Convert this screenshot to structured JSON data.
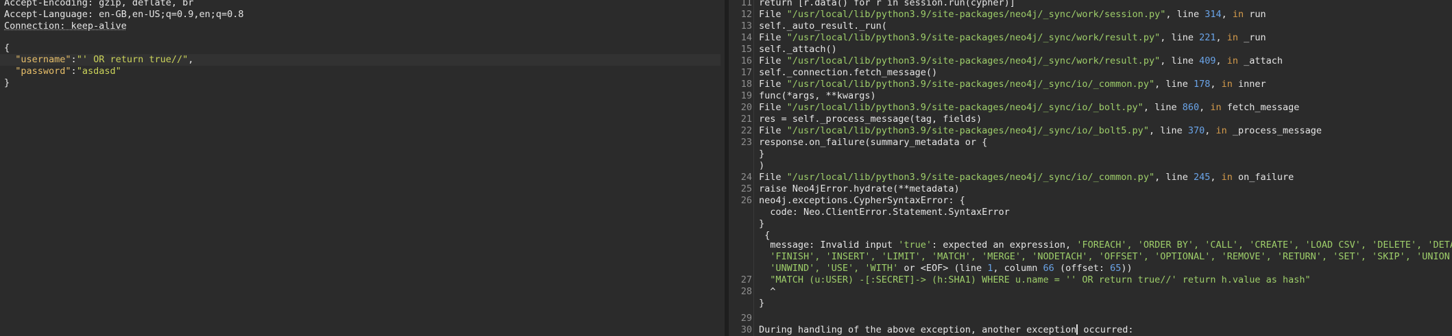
{
  "request": {
    "header_encoding": "Accept-Encoding: gzip, deflate, br",
    "header_language": "Accept-Language: en-GB,en-US;q=0.9,en;q=0.8",
    "header_connection": "Connection: keep-alive",
    "brace_open": "{",
    "username_key": "\"username\"",
    "username_val": "\"' OR return true//\"",
    "password_key": "\"password\"",
    "password_val": "\"asdasd\"",
    "brace_close": "}",
    "colon": ":",
    "comma": ","
  },
  "trace": {
    "lines": [
      {
        "n": "11",
        "a": "return [r.data() for r in session.run(cypher)]"
      },
      {
        "n": "12",
        "file": "\"/usr/local/lib/python3.9/site-packages/neo4j/_sync/work/session.py\"",
        "line": "314",
        "in": "run"
      },
      {
        "n": "13",
        "a": "self._auto_result._run("
      },
      {
        "n": "14",
        "file": "\"/usr/local/lib/python3.9/site-packages/neo4j/_sync/work/result.py\"",
        "line": "221",
        "in": "_run"
      },
      {
        "n": "15",
        "a": "self._attach()"
      },
      {
        "n": "16",
        "file": "\"/usr/local/lib/python3.9/site-packages/neo4j/_sync/work/result.py\"",
        "line": "409",
        "in": "_attach"
      },
      {
        "n": "17",
        "a": "self._connection.fetch_message()"
      },
      {
        "n": "18",
        "file": "\"/usr/local/lib/python3.9/site-packages/neo4j/_sync/io/_common.py\"",
        "line": "178",
        "in": "inner"
      },
      {
        "n": "19",
        "a": "func(*args, **kwargs)"
      },
      {
        "n": "20",
        "file": "\"/usr/local/lib/python3.9/site-packages/neo4j/_sync/io/_bolt.py\"",
        "line": "860",
        "in": "fetch_message"
      },
      {
        "n": "21",
        "a": "res = self._process_message(tag, fields)"
      },
      {
        "n": "22",
        "file": "\"/usr/local/lib/python3.9/site-packages/neo4j/_sync/io/_bolt5.py\"",
        "line": "370",
        "in": "_process_message"
      },
      {
        "n": "23",
        "a": "response.on_failure(summary_metadata or {"
      },
      {
        "n": "",
        "a": "}"
      },
      {
        "n": "",
        "a": ")"
      },
      {
        "n": "24",
        "file": "\"/usr/local/lib/python3.9/site-packages/neo4j/_sync/io/_common.py\"",
        "line": "245",
        "in": "on_failure"
      },
      {
        "n": "25",
        "a": "raise Neo4jError.hydrate(**metadata)"
      },
      {
        "n": "26",
        "a": "neo4j.exceptions.CypherSyntaxError: {"
      },
      {
        "n": "",
        "a": "  code: Neo.ClientError.Statement.SyntaxError"
      },
      {
        "n": "",
        "a": "}"
      },
      {
        "n": "",
        "a": " {"
      }
    ],
    "file_word": "File",
    "line_word": "line",
    "in_word": "in",
    "msg1_pre": "  message: Invalid input ",
    "msg1_true": "'true'",
    "msg1_mid": ": expected an expression, ",
    "msg1_list": "'FOREACH', 'ORDER BY', 'CALL', 'CREATE', 'LOAD CSV', 'DELETE', 'DETACH'",
    "msg2": "  'FINISH', 'INSERT', 'LIMIT', 'MATCH', 'MERGE', 'NODETACH', 'OFFSET', 'OPTIONAL', 'REMOVE', 'RETURN', 'SET', 'SKIP', 'UNION',",
    "msg3_a": "  'UNWIND', 'USE', 'WITH'",
    "msg3_b": " or <EOF> (line ",
    "msg3_line": "1",
    "msg3_c": ", column ",
    "msg3_col": "66",
    "msg3_d": " (offset: ",
    "msg3_off": "65",
    "msg3_e": "))",
    "n27": "27",
    "l27": "  \"MATCH (u:USER) -[:SECRET]-> (h:SHA1) WHERE u.name = '' OR return true//' return h.value as hash\"",
    "n28": "28",
    "l28": "  ^",
    "l_close": "}",
    "n29": "29",
    "n30": "30",
    "l30_a": "During handling of the above exception, another exception",
    "l30_b": " occurred:"
  }
}
